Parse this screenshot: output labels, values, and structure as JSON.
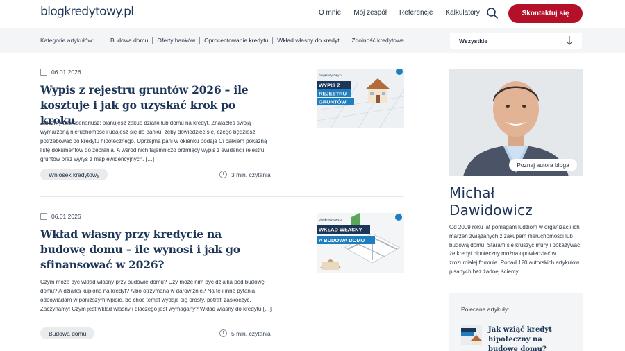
{
  "header": {
    "logo": "blogkredytowy.pl",
    "nav": [
      "O mnie",
      "Mój zespół",
      "Referencje",
      "Kalkulatory"
    ],
    "cta": "Skontaktuj się"
  },
  "categories": {
    "label": "Kategorie artykułów:",
    "links": [
      "Budowa domu",
      "Oferty banków",
      "Oprocentowanie kredytu",
      "Wkład własny do kredytu",
      "Zdolność kredytowa"
    ],
    "select_value": "Wszystkie"
  },
  "articles": [
    {
      "date": "06.01.2026",
      "title": "Wypis z rejestru gruntów 2026 – ile kosztuje i jak go uzyskać krok po kroku",
      "excerpt": "Założmy taki scenariusz: planujesz zakup działki lub domu na kredyt. Znalazłeś swoją wymarzoną nieruchomość i udajesz się do banku, żeby dowiedzieć się, czego będziesz potrzebować do kredytu hipotecznego. Uprzejma pani w okienku podaje Ci całkiem pokaźną listę dokumentów do zebrania. A wśród nich tajemniczo brzmiący wypis z ewidencji rejestru gruntów oraz wyrys z map ewidencyjnych. […]",
      "tag": "Wniosek kredytowy",
      "read_time": "3 min. czytania",
      "thumb_brand": "blogkredytowy.pl",
      "thumb_lines": [
        "WYPIS Z",
        "REJESTRU",
        "GRUNTÓW"
      ]
    },
    {
      "date": "06.01.2026",
      "title": "Wkład własny przy kredycie na budowę domu – ile wynosi i jak go sfinansować w 2026?",
      "excerpt": "Czym może być wkład własny przy budowie domu? Czy może nim być działka pod budowę domu? A działka kupiona na kredyt? Albo otrzymana w darowiźnie? Na te i inne pytania odpowiadam w poniższym wpisie, bo choć temat wydaje się prosty, potrafi zaskoczyć. Zaczynamy! Czym jest wkład własny i dlaczego jest wymagany? Wkład własny do kredytu […]",
      "tag": "Budowa domu",
      "read_time": "5 min. czytania",
      "thumb_brand": "blogkredytowy.pl",
      "thumb_lines": [
        "WKŁAD WŁASNY",
        "A BUDOWA DOMU"
      ]
    }
  ],
  "sidebar": {
    "author_button": "Poznaj autora bloga",
    "author_first": "Michał",
    "author_last": "Dawidowicz",
    "bio": "Od 2009 roku lat pomagam ludziom w organizacji ich marzeń związanych z zakupem nieruchomości lub budową domu. Staram się kruszyć mury i pokazywać, że kredyt hipoteczny można opowiedzieć w zrozumiałej formule. Ponad 120 autorskich artykułów pisanych bez żadnej ściemy.",
    "recommended_label": "Polecane artykuły:",
    "recommended_title": "Jak wziąć kredyt hipoteczny na budowę domu? Kompletny"
  },
  "colors": {
    "brand_navy": "#1d3557",
    "cta_red": "#b5102a",
    "thumb_blue": "#1f7ec0"
  }
}
